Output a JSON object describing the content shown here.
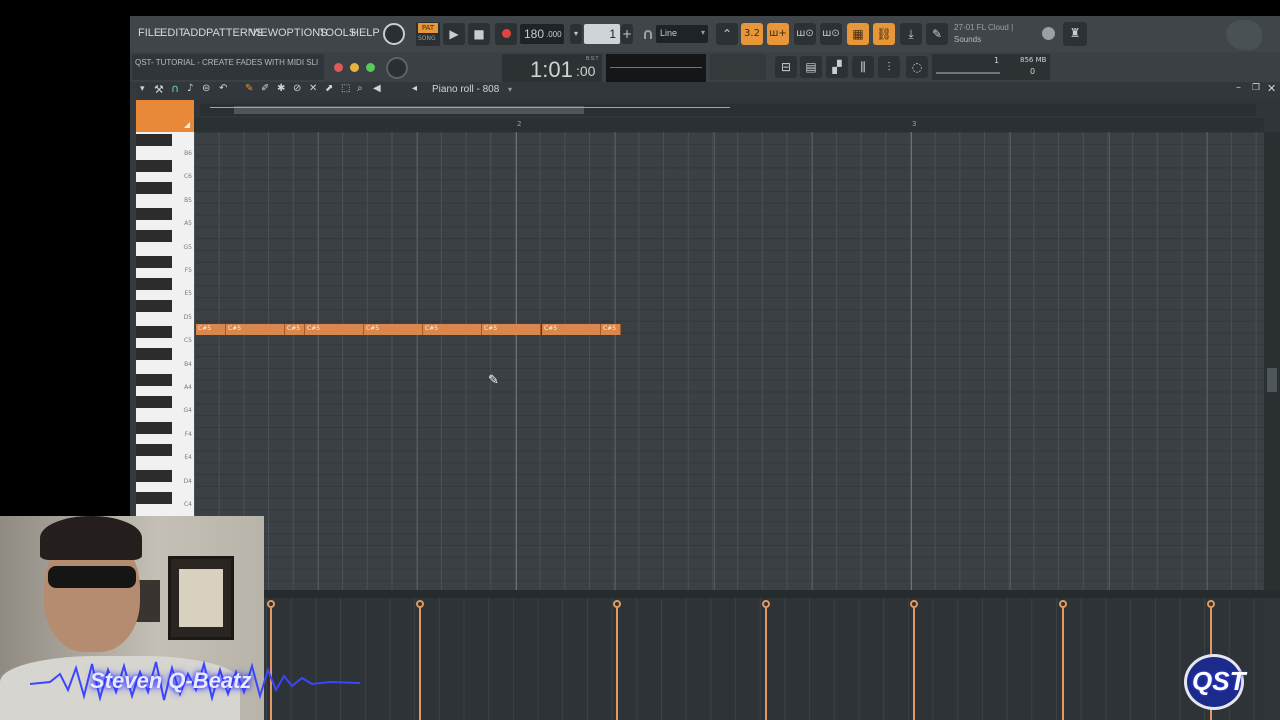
{
  "menu": [
    "FILE",
    "EDIT",
    "ADD",
    "PATTERNS",
    "VIEW",
    "OPTIONS",
    "TOOLS",
    "HELP"
  ],
  "transport": {
    "pat_label": "PAT",
    "song_label": "SONG",
    "tempo_int": "180",
    "tempo_dec": ".000",
    "pattern_number": "1",
    "snap": "Line",
    "time_main": "1:01",
    "time_sub": ":00",
    "time_unit": "B:S:T"
  },
  "news": {
    "line1": "27-01  FL Cloud |",
    "line2": "Sounds"
  },
  "hint": {
    "title": "QST- TUTORIAL - CREATE FADES WITH MIDI SLI"
  },
  "cpu": {
    "cores": "1",
    "memory": "856 MB",
    "polyphony": "0"
  },
  "piano_roll": {
    "title": "Piano roll - 808",
    "bars": [
      "2",
      "3"
    ],
    "key_labels": [
      "B6",
      "C6",
      "B5",
      "A5",
      "G5",
      "F5",
      "E5",
      "D5",
      "C5",
      "B4",
      "A4",
      "G4",
      "F4",
      "E4",
      "D4",
      "C4"
    ],
    "notes": [
      {
        "label": "C#5",
        "start": 0.0,
        "len": 0.3
      },
      {
        "label": "C#5",
        "start": 0.3,
        "len": 0.6
      },
      {
        "label": "C#5",
        "start": 0.9,
        "len": 0.2
      },
      {
        "label": "C#5",
        "start": 1.1,
        "len": 0.6
      },
      {
        "label": "C#5",
        "start": 1.7,
        "len": 0.6
      },
      {
        "label": "C#5",
        "start": 2.3,
        "len": 0.6
      },
      {
        "label": "C#5",
        "start": 2.9,
        "len": 0.6
      },
      {
        "label": "C#5",
        "start": 3.5,
        "len": 0.6
      },
      {
        "label": "C#5",
        "start": 4.1,
        "len": 0.2
      }
    ],
    "velocity": [
      1,
      1,
      1,
      1,
      1,
      1,
      1
    ]
  },
  "overlay": {
    "name": "Steven Q-Beatz",
    "logo": "QST"
  },
  "colors": {
    "accent": "#e7963a",
    "note": "#d9874c",
    "grid": "#3a4044"
  }
}
